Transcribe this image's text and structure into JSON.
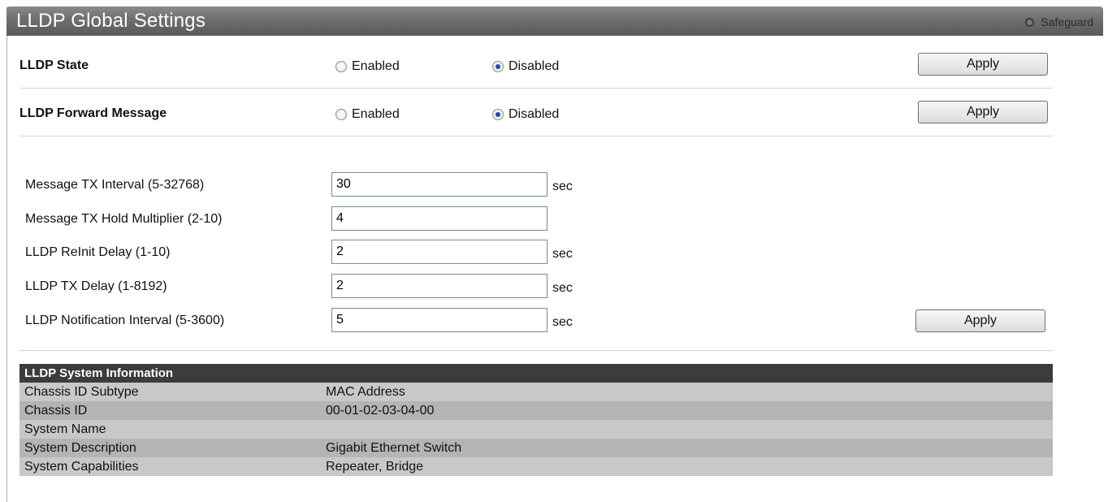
{
  "header": {
    "title": "LLDP Global Settings",
    "safeguard_label": "Safeguard"
  },
  "lldp_state": {
    "label": "LLDP State",
    "options": [
      "Enabled",
      "Disabled"
    ],
    "selected": "Disabled",
    "apply_label": "Apply"
  },
  "lldp_forward": {
    "label": "LLDP Forward Message",
    "options": [
      "Enabled",
      "Disabled"
    ],
    "selected": "Disabled",
    "apply_label": "Apply"
  },
  "params": [
    {
      "label": "Message TX Interval (5-32768)",
      "value": "30",
      "unit": "sec"
    },
    {
      "label": "Message TX Hold Multiplier (2-10)",
      "value": "4",
      "unit": ""
    },
    {
      "label": "LLDP ReInit Delay (1-10)",
      "value": "2",
      "unit": "sec"
    },
    {
      "label": "LLDP TX Delay (1-8192)",
      "value": "2",
      "unit": "sec"
    },
    {
      "label": "LLDP Notification Interval (5-3600)",
      "value": "5",
      "unit": "sec"
    }
  ],
  "params_apply_label": "Apply",
  "system_info": {
    "title": "LLDP System Information",
    "rows": [
      {
        "key": "Chassis ID Subtype",
        "value": "MAC Address"
      },
      {
        "key": "Chassis ID",
        "value": "00-01-02-03-04-00"
      },
      {
        "key": "System Name",
        "value": ""
      },
      {
        "key": "System Description",
        "value": "Gigabit Ethernet Switch"
      },
      {
        "key": "System Capabilities",
        "value": "Repeater, Bridge"
      }
    ]
  },
  "colors": {
    "title_bar": "#6e6e6e",
    "table_header": "#3c3c3c",
    "radio_selected": "#1a4fa8"
  }
}
